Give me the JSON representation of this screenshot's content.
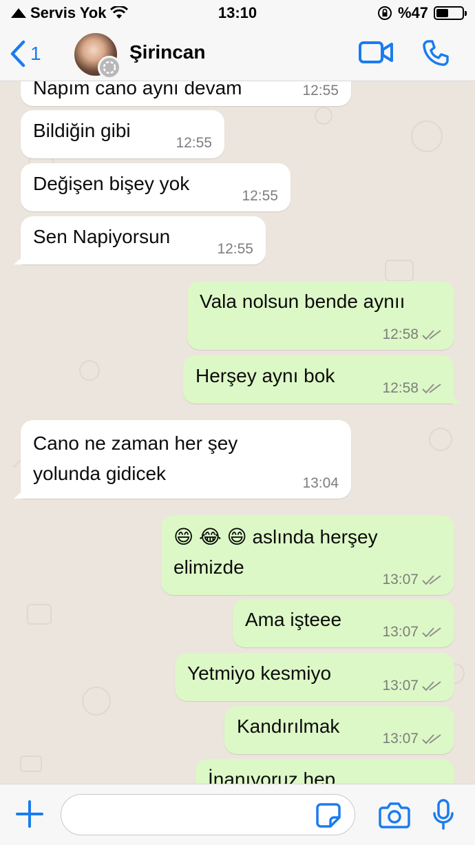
{
  "status_bar": {
    "carrier": "Servis Yok",
    "time": "13:10",
    "battery": "%47",
    "battery_level": 0.47
  },
  "header": {
    "back_count": "1",
    "contact_name": "Şirincan"
  },
  "messages": [
    {
      "direction": "in",
      "text": "Napım cano aynı devam",
      "time": "12:55"
    },
    {
      "direction": "in",
      "text": "Bildiğin gibi",
      "time": "12:55"
    },
    {
      "direction": "in",
      "text": "Değişen bişey yok",
      "time": "12:55"
    },
    {
      "direction": "in",
      "text": "Sen Napiyorsun",
      "time": "12:55"
    },
    {
      "direction": "out",
      "text": "Vala nolsun bende aynıı",
      "time": "12:58"
    },
    {
      "direction": "out",
      "text": "Herşey aynı bok",
      "time": "12:58"
    },
    {
      "direction": "in",
      "text_lines": [
        "Cano ne zaman her şey",
        "yolunda gidicek"
      ],
      "time": "13:04"
    },
    {
      "direction": "out",
      "emoji": [
        "😄",
        "😂",
        "😄"
      ],
      "text_lines": [
        "aslında herşey",
        "elimizde"
      ],
      "time": "13:07"
    },
    {
      "direction": "out",
      "text": "Ama işteee",
      "time": "13:07"
    },
    {
      "direction": "out",
      "text": "Yetmiyo kesmiyo",
      "time": "13:07"
    },
    {
      "direction": "out",
      "text": "Kandırılmak",
      "time": "13:07"
    },
    {
      "direction": "out",
      "text": "İnanıyoruz hep",
      "time": ""
    }
  ],
  "input": {
    "placeholder": ""
  },
  "colors": {
    "accent": "#1a7cf0",
    "incoming_bubble": "#ffffff",
    "outgoing_bubble": "#dcf8c6",
    "chat_background": "#ece5dd"
  },
  "icons": [
    "wifi-icon",
    "lock-rotation-icon",
    "back-chevron-icon",
    "video-call-icon",
    "phone-icon",
    "plus-icon",
    "sticker-icon",
    "camera-icon",
    "microphone-icon",
    "double-check-icon"
  ]
}
